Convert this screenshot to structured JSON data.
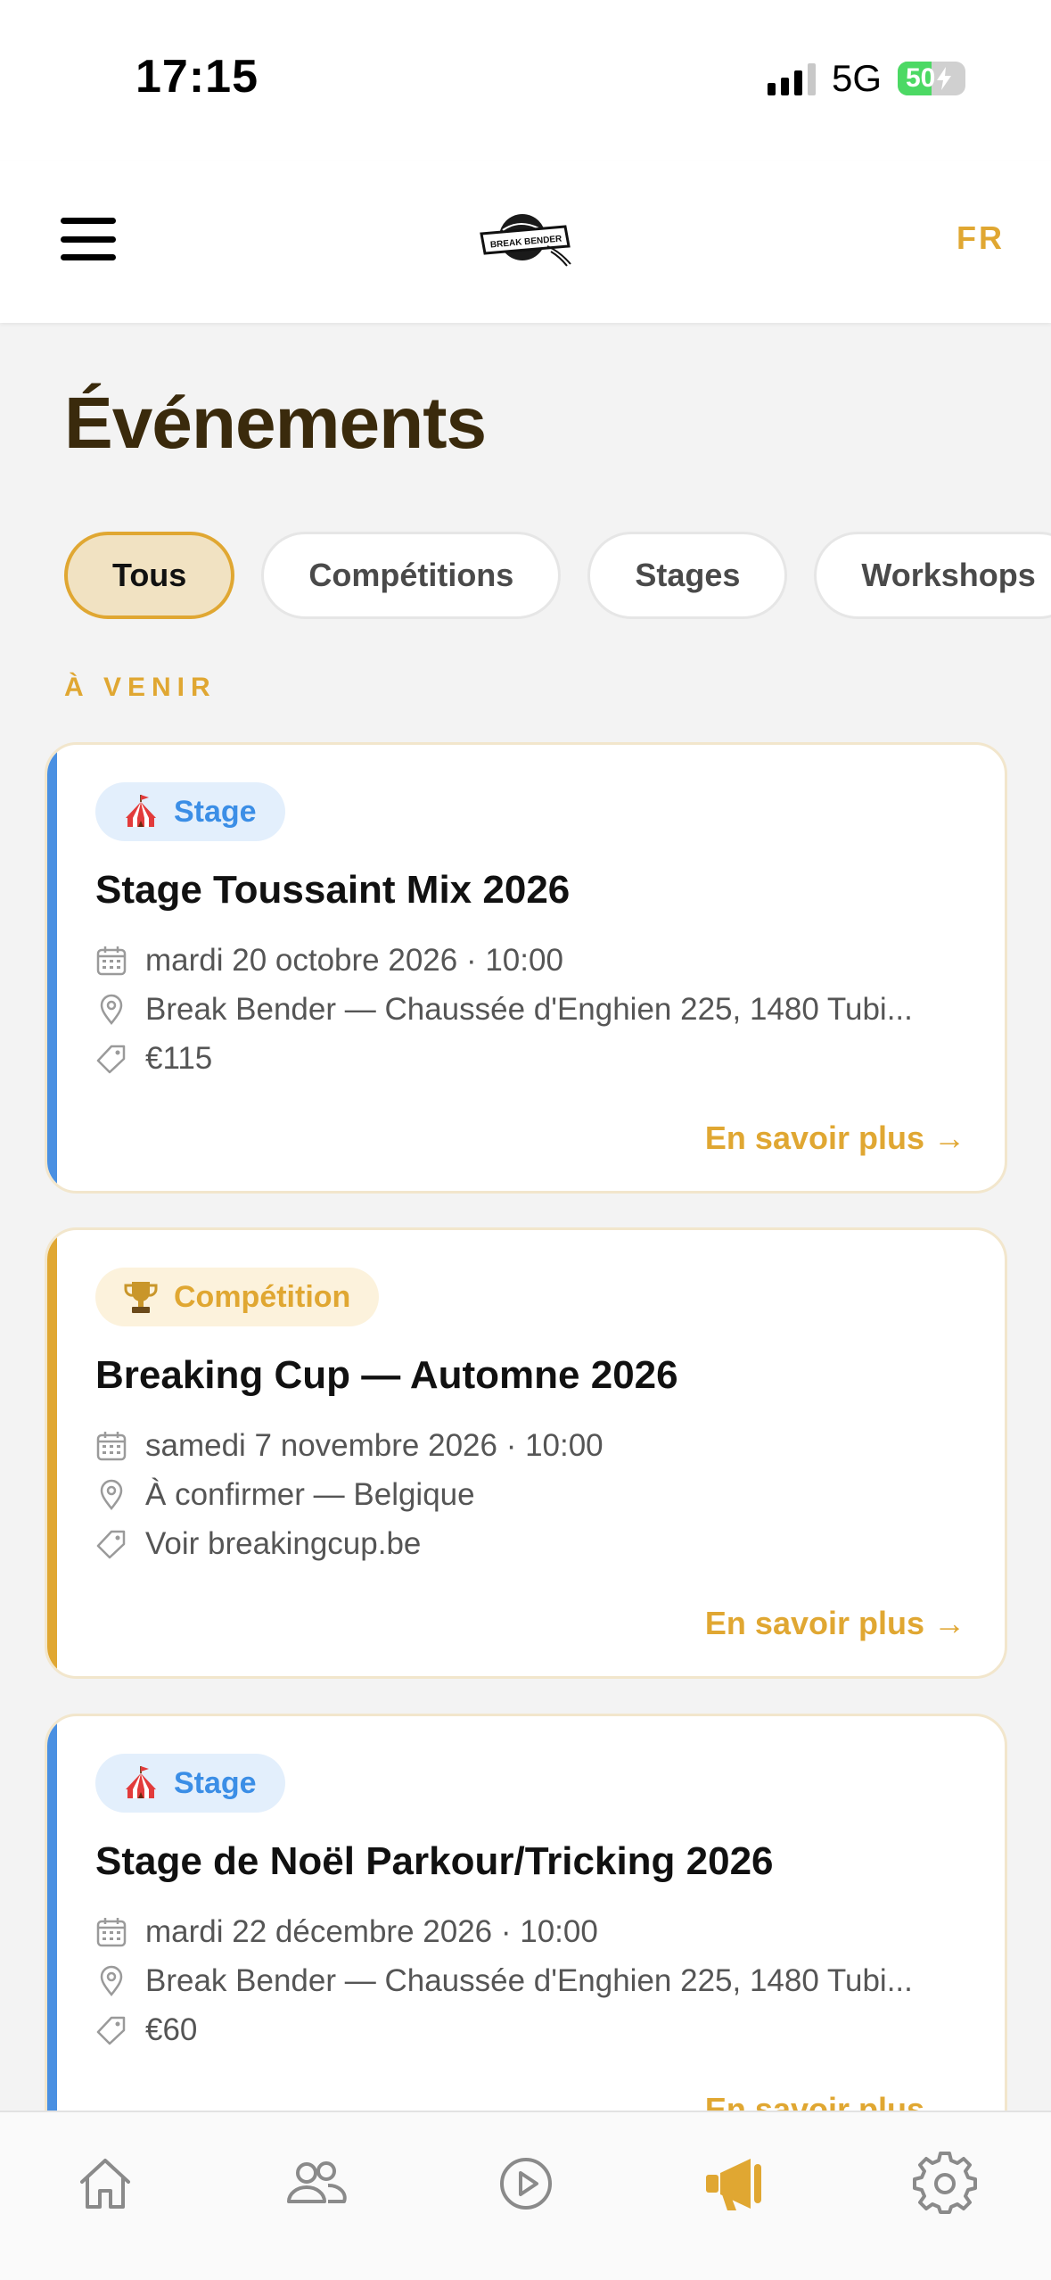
{
  "status_bar": {
    "time": "17:15",
    "network": "5G",
    "battery": "50"
  },
  "header": {
    "logo_text": "BREAK BENDER",
    "language": "FR"
  },
  "page": {
    "title": "Événements"
  },
  "filters": [
    {
      "label": "Tous",
      "active": true
    },
    {
      "label": "Compétitions",
      "active": false
    },
    {
      "label": "Stages",
      "active": false
    },
    {
      "label": "Workshops",
      "active": false
    }
  ],
  "section": {
    "label": "À VENIR"
  },
  "events": [
    {
      "type": "Stage",
      "type_icon": "circus-tent-icon",
      "accent": "#4a90e2",
      "title": "Stage Toussaint Mix 2026",
      "date": "mardi 20 octobre 2026 · 10:00",
      "location": "Break Bender — Chaussée d'Enghien 225, 1480 Tubi...",
      "price": "€115",
      "link": "En savoir plus →"
    },
    {
      "type": "Compétition",
      "type_icon": "trophy-icon",
      "accent": "#e0a732",
      "title": "Breaking Cup — Automne 2026",
      "date": "samedi 7 novembre 2026 · 10:00",
      "location": "À confirmer — Belgique",
      "price": "Voir breakingcup.be",
      "link": "En savoir plus →"
    },
    {
      "type": "Stage",
      "type_icon": "circus-tent-icon",
      "accent": "#4a90e2",
      "title": "Stage de Noël Parkour/Tricking 2026",
      "date": "mardi 22 décembre 2026 · 10:00",
      "location": "Break Bender — Chaussée d'Enghien 225, 1480 Tubi...",
      "price": "€60",
      "link": "En savoir plus →"
    }
  ],
  "bottom_nav": [
    {
      "icon": "home-icon",
      "active": false
    },
    {
      "icon": "users-icon",
      "active": false
    },
    {
      "icon": "play-icon",
      "active": false
    },
    {
      "icon": "megaphone-icon",
      "active": true
    },
    {
      "icon": "gear-icon",
      "active": false
    }
  ],
  "colors": {
    "accent": "#e0a732",
    "stage_blue": "#4a90e2",
    "title_brown": "#3a2a0c",
    "background": "#f3f3f3"
  }
}
